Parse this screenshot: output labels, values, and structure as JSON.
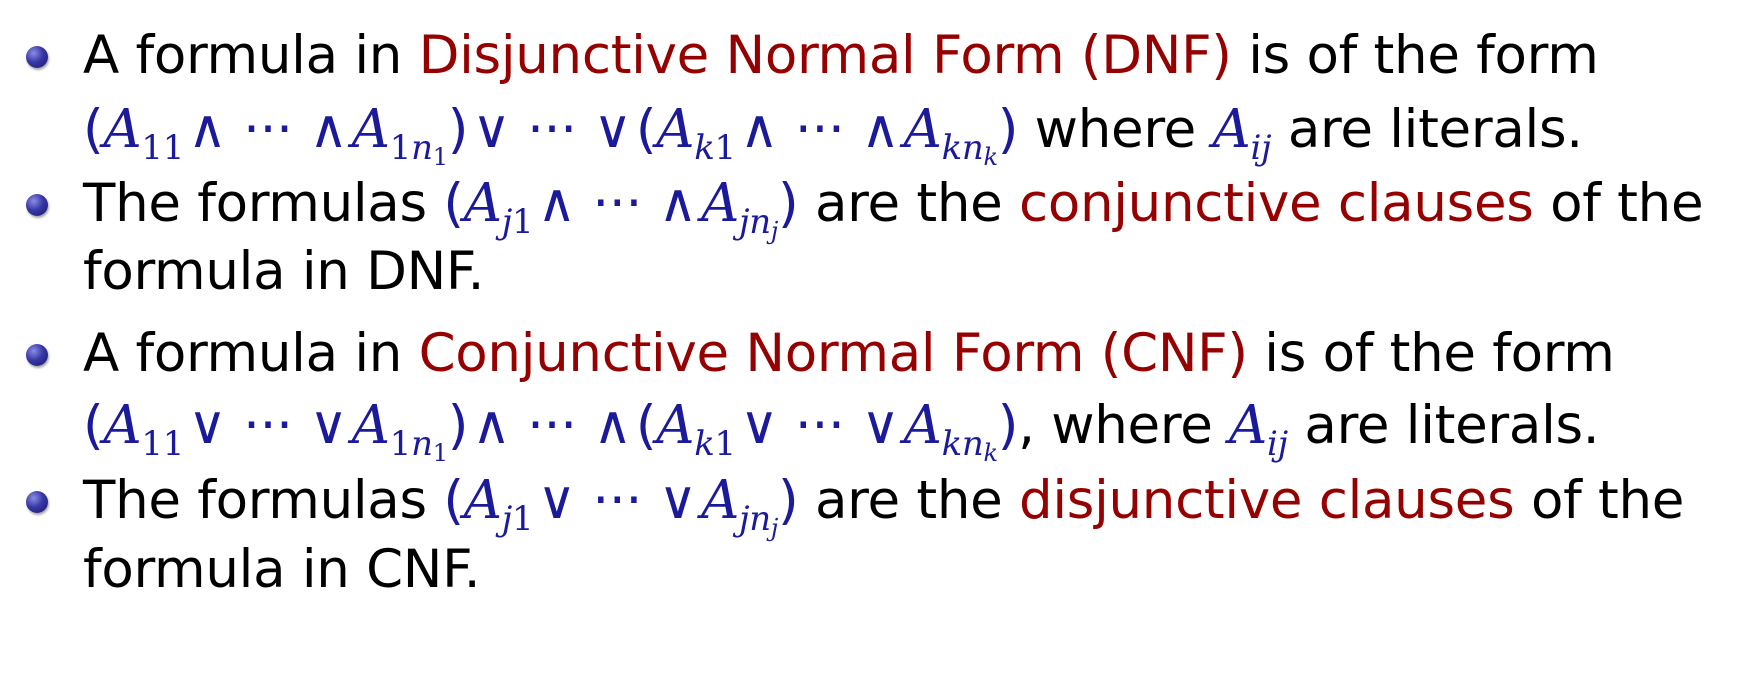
{
  "items": [
    {
      "line1": {
        "pre": "A formula in ",
        "term": "Disjunctive Normal Form (DNF)",
        "post": " is of the form"
      },
      "line2": {
        "post": " where ",
        "math_a": "A",
        "math_a_sub": "ij",
        "tail": " are literals."
      }
    },
    {
      "line1": {
        "pre": "The formulas ",
        "mid": " are the ",
        "term": "conjunctive clauses",
        "post": " of the"
      },
      "line2": {
        "text": "formula in DNF."
      }
    },
    {
      "line1": {
        "pre": "A formula in ",
        "term": "Conjunctive Normal Form (CNF)",
        "post": " is of the form"
      },
      "line2": {
        "post": ", where ",
        "math_a": "A",
        "math_a_sub": "ij",
        "tail": " are literals."
      }
    },
    {
      "line1": {
        "pre": "The formulas ",
        "mid": " are the ",
        "term": "disjunctive clauses",
        "post": " of the"
      },
      "line2": {
        "text": "formula in CNF."
      }
    }
  ],
  "colors": {
    "term": "#950000",
    "math": "#1a1a9a",
    "text": "#000000"
  }
}
